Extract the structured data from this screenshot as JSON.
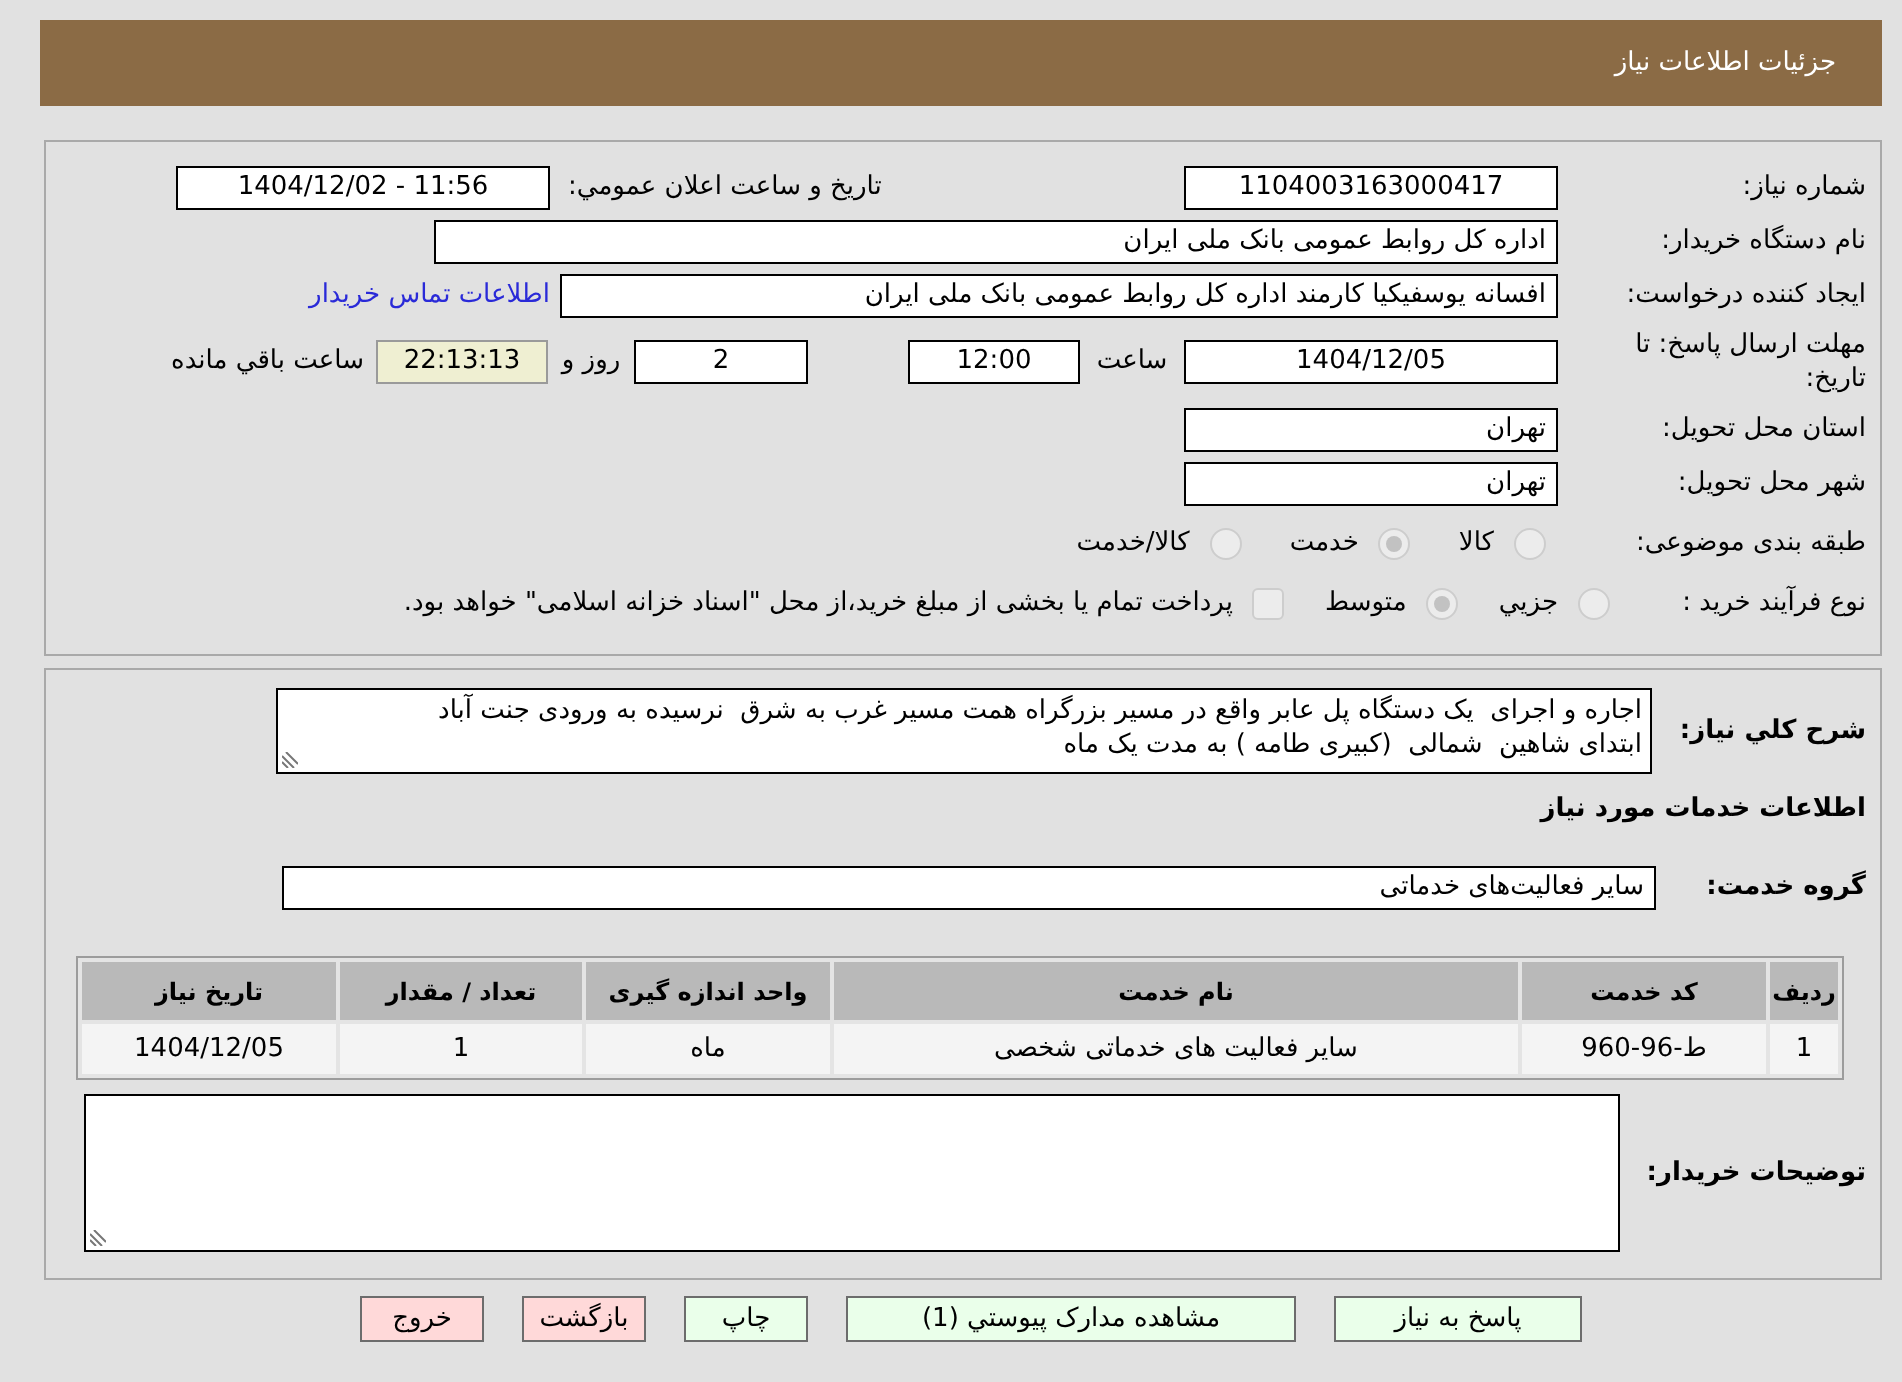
{
  "header": {
    "title": "جزئیات اطلاعات نیاز"
  },
  "details": {
    "need_number": {
      "label": "شماره نیاز:",
      "value": "1104003163000417"
    },
    "announcement": {
      "label": "تاریخ و ساعت اعلان عمومي:",
      "value": "1404/12/02 - 11:56"
    },
    "buyer": {
      "label": "نام دستگاه خریدار:",
      "value": "اداره کل روابط عمومی بانک ملی ایران"
    },
    "requester": {
      "label": "ایجاد کننده درخواست:",
      "value": "افسانه یوسفیکیا کارمند اداره کل روابط عمومی بانک ملی ایران",
      "contact_link": "اطلاعات تماس خریدار"
    },
    "deadline": {
      "label": "مهلت ارسال پاسخ: تا تاریخ:",
      "date": "1404/12/05",
      "time_label": "ساعت",
      "time": "12:00",
      "days": "2",
      "days_label": "روز و",
      "remaining": "22:13:13",
      "remaining_label": "ساعت باقي مانده"
    },
    "province": {
      "label": "استان محل تحویل:",
      "value": "تهران"
    },
    "city": {
      "label": "شهر محل تحویل:",
      "value": "تهران"
    },
    "category": {
      "label": "طبقه بندی موضوعی:",
      "options": [
        {
          "label": "کالا",
          "selected": false
        },
        {
          "label": "خدمت",
          "selected": true
        },
        {
          "label": "کالا/خدمت",
          "selected": false
        }
      ]
    },
    "purchase_type": {
      "label": "نوع فرآیند خرید :",
      "options": [
        {
          "label": "جزيي",
          "selected": false
        },
        {
          "label": "متوسط",
          "selected": true
        }
      ],
      "treasury_option": {
        "label": "پرداخت تمام یا بخشی از مبلغ خرید،از محل \"اسناد خزانه اسلامی\" خواهد بود.",
        "checked": false
      }
    }
  },
  "description": {
    "label": "شرح کلي نياز:",
    "value": "اجاره و اجرای  یک دستگاه پل عابر واقع در مسیر بزرگراه همت مسیر غرب به شرق  نرسیده به ورودی جنت آباد ابتدای شاهین  شمالی  (کبیری طامه ) به مدت یک ماه"
  },
  "services": {
    "heading": "اطلاعات خدمات مورد نیاز",
    "group": {
      "label": "گروه خدمت:",
      "value": "سایر فعالیت‌های خدماتی"
    },
    "table": {
      "columns": [
        "ردیف",
        "کد خدمت",
        "نام خدمت",
        "واحد اندازه گیری",
        "تعداد / مقدار",
        "تاریخ نیاز"
      ],
      "rows": [
        [
          "1",
          "ط-96-960",
          "سایر فعالیت های خدماتی شخصی",
          "ماه",
          "1",
          "1404/12/05"
        ]
      ]
    }
  },
  "buyer_notes": {
    "label": "توضیحات خریدار:"
  },
  "buttons": [
    {
      "label": "پاسخ به نیاز",
      "color": "#eaffea"
    },
    {
      "label": "مشاهده مدارک پیوستي (1)",
      "color": "#eaffea"
    },
    {
      "label": "چاپ",
      "color": "#eaffea"
    },
    {
      "label": "بازگشت",
      "color": "#ffd9d9"
    },
    {
      "label": "خروج",
      "color": "#ffd9d9"
    }
  ]
}
